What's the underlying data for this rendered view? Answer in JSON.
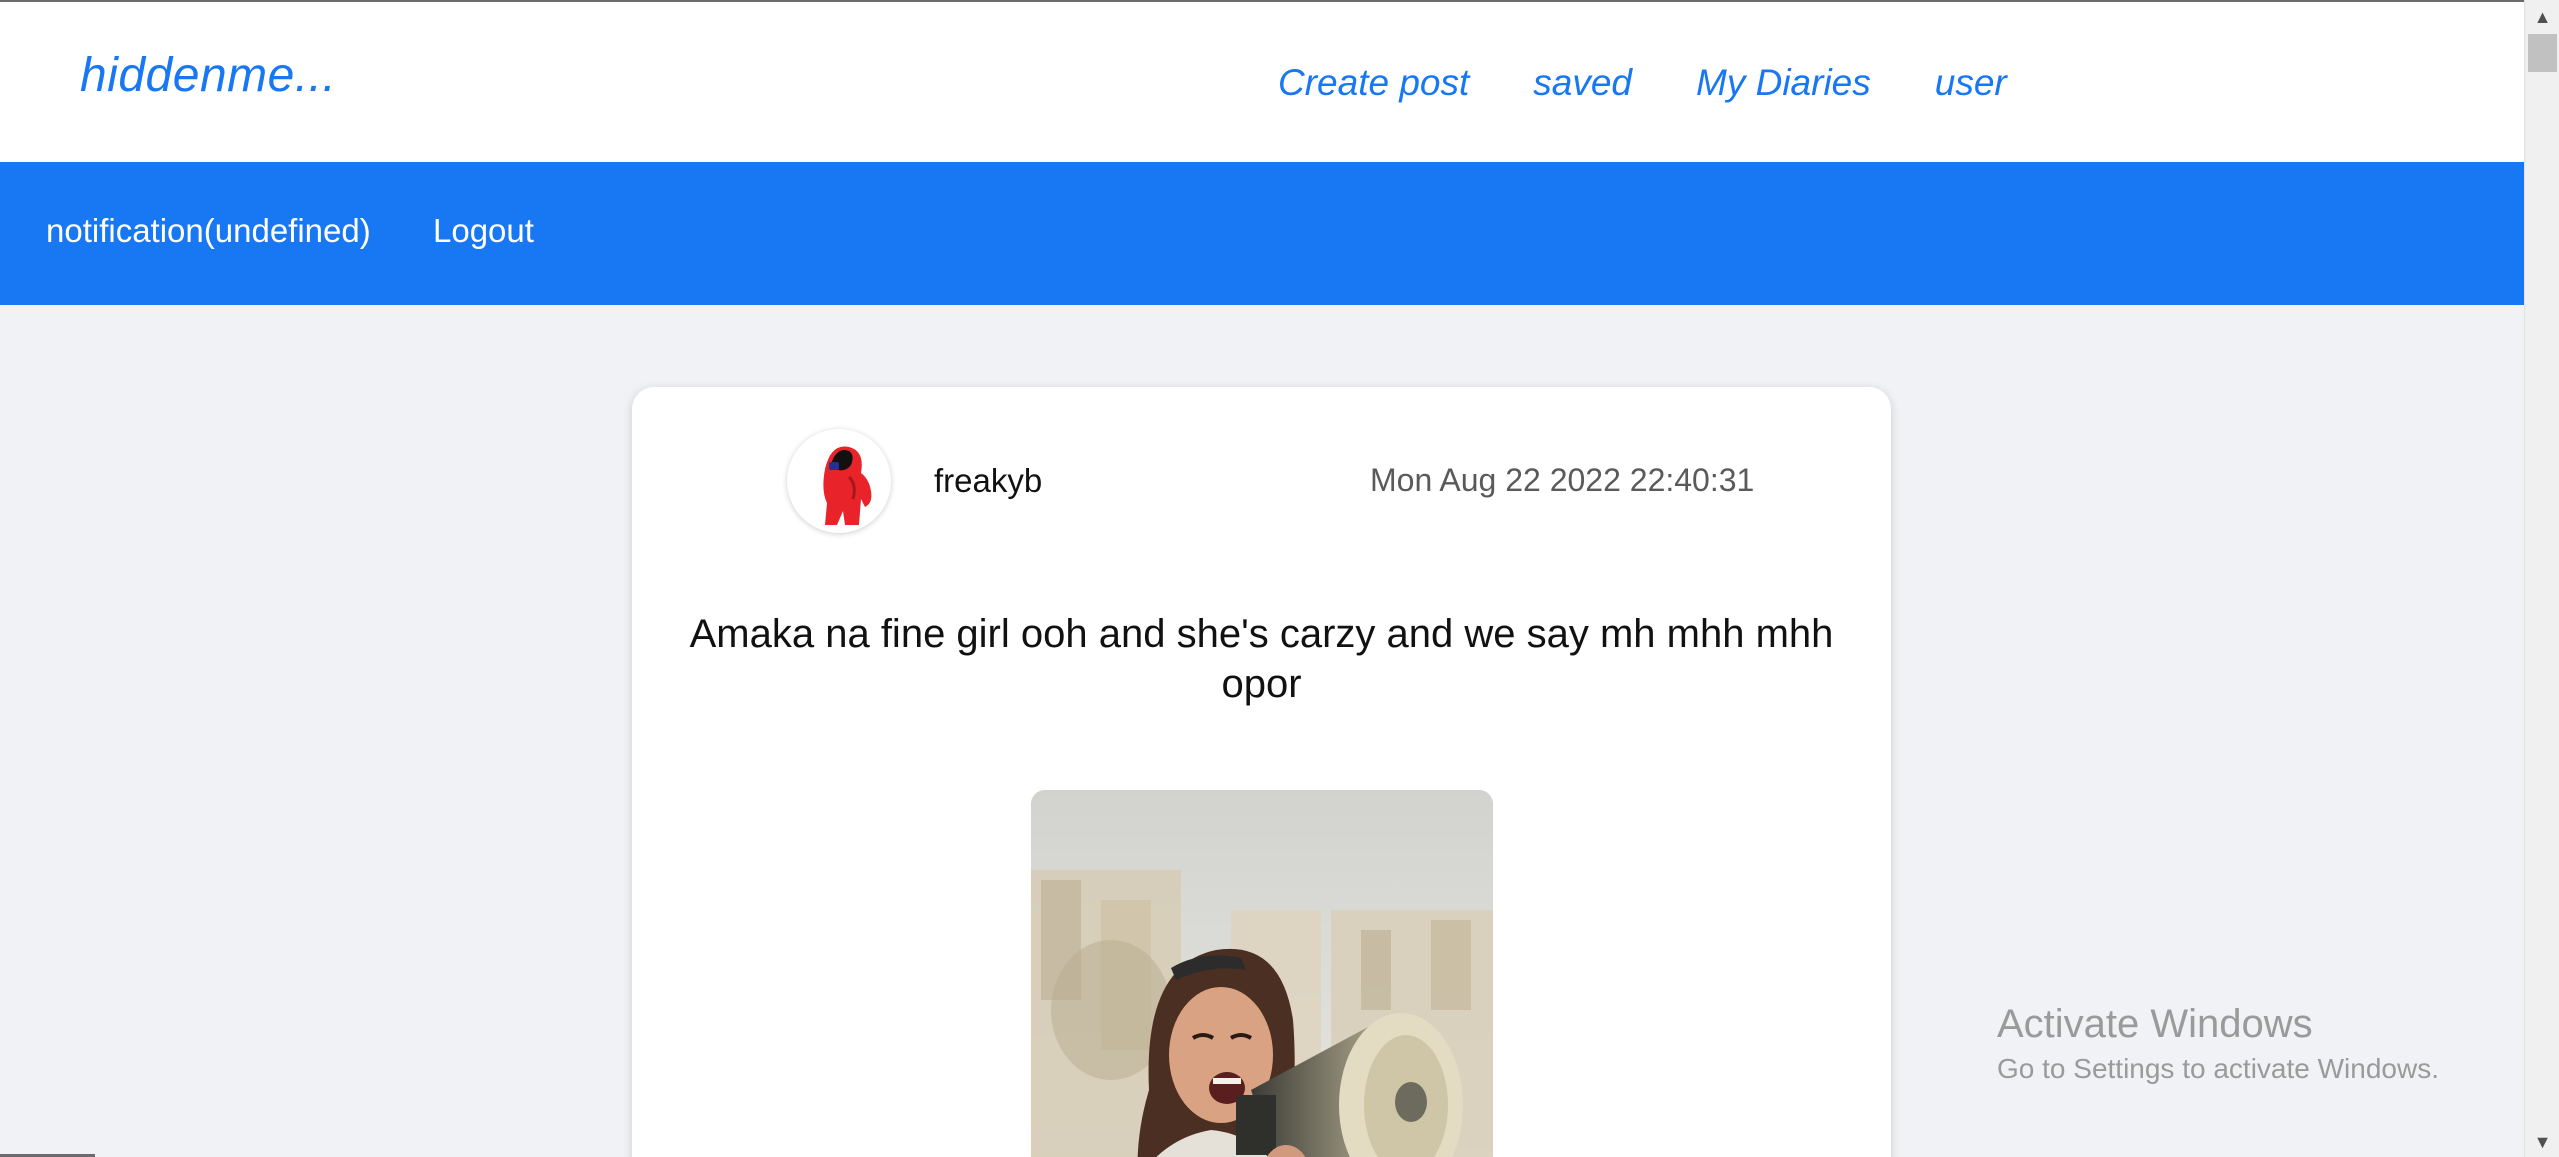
{
  "header": {
    "logo": "hiddenme...",
    "nav": [
      {
        "label": "Create post"
      },
      {
        "label": "saved"
      },
      {
        "label": "My Diaries"
      },
      {
        "label": "user"
      }
    ]
  },
  "subnav": {
    "notification": "notification(undefined)",
    "logout": "Logout"
  },
  "post": {
    "author": "freakyb",
    "timestamp": "Mon Aug 22 2022 22:40:31",
    "text": "Amaka na fine girl ooh and she's carzy and we say mh mhh mhh opor",
    "avatar_icon": "red-hooded-character-avatar",
    "image_icon": "woman-with-megaphone-photo"
  },
  "watermark": {
    "title": "Activate Windows",
    "subtitle": "Go to Settings to activate Windows."
  },
  "colors": {
    "brand": "#1877f2",
    "background": "#f0f2f5",
    "card": "#ffffff"
  }
}
